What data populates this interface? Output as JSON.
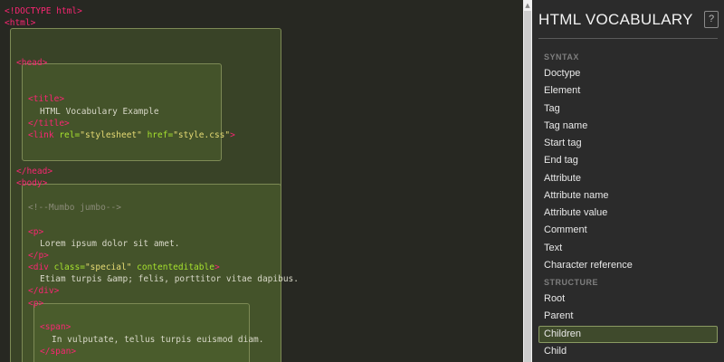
{
  "code": {
    "lines": [
      [
        {
          "t": "<!DOCTYPE html>",
          "c": "tag"
        }
      ],
      [
        {
          "t": "<html>",
          "c": "tag"
        }
      ],
      [
        {
          "t": "<head>",
          "c": "tag"
        }
      ],
      [
        {
          "t": "<title>",
          "c": "tag"
        }
      ],
      [
        {
          "t": "HTML Vocabulary Example",
          "c": "plain"
        }
      ],
      [
        {
          "t": "</title>",
          "c": "tag"
        }
      ],
      [
        {
          "t": "<link ",
          "c": "tag"
        },
        {
          "t": "rel=",
          "c": "attr"
        },
        {
          "t": "\"stylesheet\"",
          "c": "str"
        },
        {
          "t": " href=",
          "c": "attr"
        },
        {
          "t": "\"style.css\"",
          "c": "str"
        },
        {
          "t": ">",
          "c": "tag"
        }
      ],
      [
        {
          "t": "</head>",
          "c": "tag"
        }
      ],
      [
        {
          "t": "<body>",
          "c": "tag"
        }
      ],
      [
        {
          "t": "<!--Mumbo jumbo-->",
          "c": "cmt"
        }
      ],
      [
        {
          "t": "<p>",
          "c": "tag"
        }
      ],
      [
        {
          "t": "Lorem ipsum dolor sit amet.",
          "c": "plain"
        }
      ],
      [
        {
          "t": "</p>",
          "c": "tag"
        }
      ],
      [
        {
          "t": "<div ",
          "c": "tag"
        },
        {
          "t": "class=",
          "c": "attr"
        },
        {
          "t": "\"special\"",
          "c": "str"
        },
        {
          "t": " contenteditable",
          "c": "attr"
        },
        {
          "t": ">",
          "c": "tag"
        }
      ],
      [
        {
          "t": "Etiam turpis &amp; felis, porttitor vitae dapibus.",
          "c": "plain"
        }
      ],
      [
        {
          "t": "</div>",
          "c": "tag"
        }
      ],
      [
        {
          "t": "<p>",
          "c": "tag"
        }
      ],
      [
        {
          "t": "<span>",
          "c": "tag"
        }
      ],
      [
        {
          "t": "In vulputate, tellus turpis euismod diam.",
          "c": "plain"
        }
      ],
      [
        {
          "t": "</span>",
          "c": "tag"
        }
      ]
    ]
  },
  "vocab": {
    "title": "HTML VOCABULARY",
    "help_label": "?",
    "sections": [
      {
        "label": "SYNTAX",
        "items": [
          "Doctype",
          "Element",
          "Tag",
          "Tag name",
          "Start tag",
          "End tag",
          "Attribute",
          "Attribute name",
          "Attribute value",
          "Comment",
          "Text",
          "Character reference"
        ]
      },
      {
        "label": "STRUCTURE",
        "items": [
          "Root",
          "Parent",
          "Children",
          "Child"
        ]
      }
    ],
    "active_item": "Children"
  },
  "colors": {
    "background": "#272822",
    "tag": "#f92672",
    "attribute": "#a6e22e",
    "string": "#e6db74",
    "box_border": "#7d8a55",
    "sidebar_bg": "#2b2b2b",
    "active_bg": "#3f4a2c"
  }
}
